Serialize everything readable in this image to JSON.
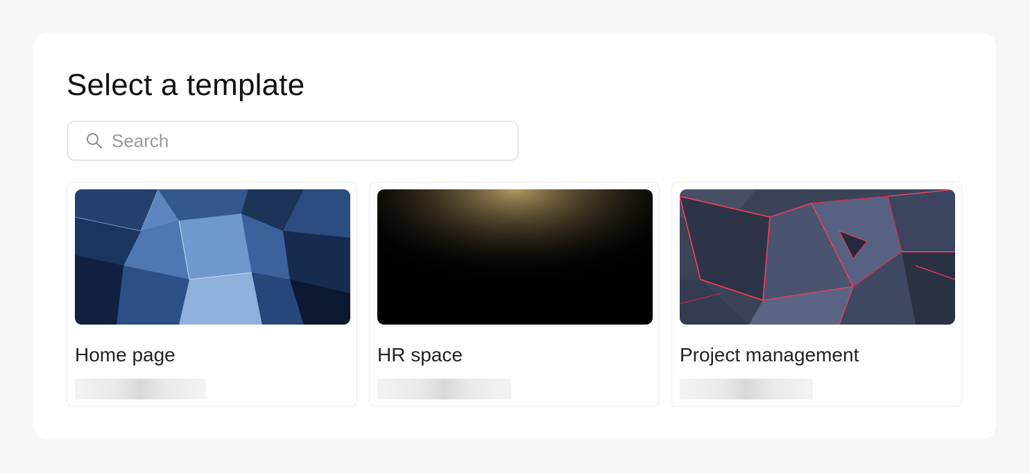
{
  "header": {
    "title": "Select a template"
  },
  "search": {
    "placeholder": "Search",
    "value": "",
    "icon": "search-icon"
  },
  "templates": [
    {
      "label": "Home page",
      "thumbnail": "blue-geometric-glass-image",
      "accent": "#2b4f86"
    },
    {
      "label": "HR space",
      "thumbnail": "golden-light-streaks-image",
      "accent": "#d48a1e"
    },
    {
      "label": "Project management",
      "thumbnail": "red-neon-polygon-image",
      "accent": "#e0324a"
    }
  ],
  "colors": {
    "background": "#f8f7f5",
    "panel": "#ffffff",
    "border": "#ececec",
    "text": "#111111",
    "placeholder": "#9a9a9a"
  }
}
